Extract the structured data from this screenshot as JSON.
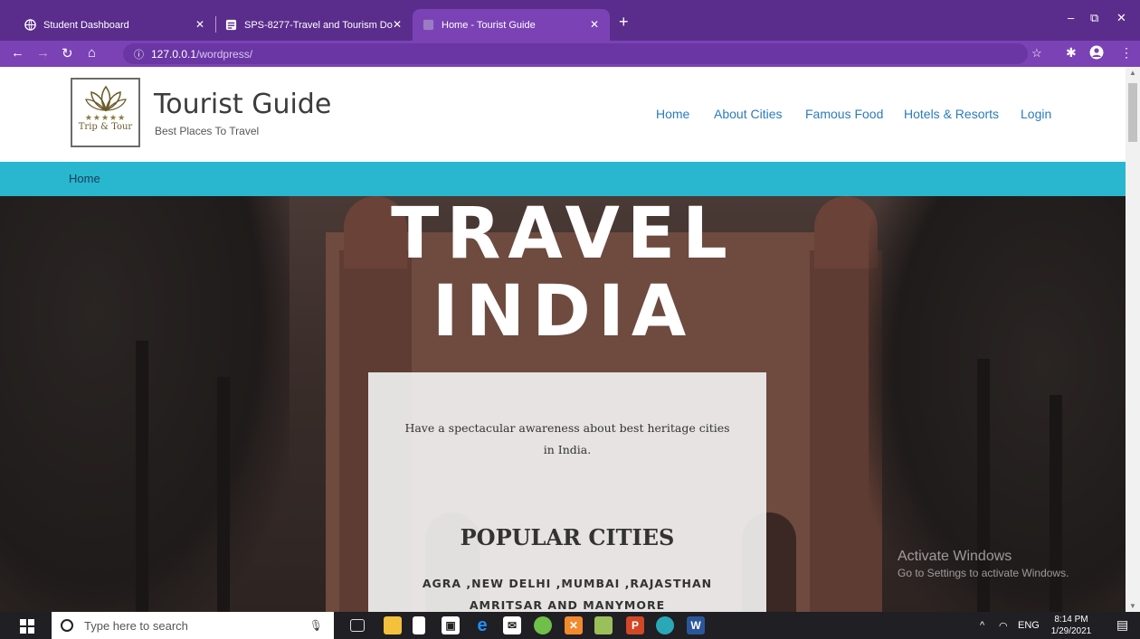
{
  "browser": {
    "tabs": [
      {
        "title": "Student Dashboard"
      },
      {
        "title": "SPS-8277-Travel and Tourism Do"
      },
      {
        "title": "Home - Tourist Guide"
      }
    ],
    "new_tab": "+",
    "window_controls": {
      "minimize": "–",
      "maximize": "⧉",
      "close": "✕"
    },
    "url_host": "127.0.0.1",
    "url_path": "/wordpress/"
  },
  "site": {
    "logo_stars": "★★★★★",
    "logo_text": "Trip & Tour",
    "title": "Tourist Guide",
    "tagline": "Best Places To Travel",
    "nav": [
      "Home",
      "About Cities",
      "Famous Food",
      "Hotels & Resorts",
      "Login"
    ],
    "breadcrumb": "Home"
  },
  "hero": {
    "title_line1": "TRAVEL",
    "title_line2": "INDIA",
    "card_text": "Have a spectacular awareness about best heritage cities in India.",
    "card_heading": "POPULAR CITIES",
    "card_cities": "AGRA ,NEW DELHI ,MUMBAI ,RAJASTHAN AMRITSAR AND MANYMORE"
  },
  "watermark": {
    "line1": "Activate Windows",
    "line2": "Go to Settings to activate Windows."
  },
  "taskbar": {
    "search_placeholder": "Type here to search",
    "tray_lang": "ENG",
    "time": "8:14 PM",
    "date": "1/29/2021"
  },
  "colors": {
    "browser_frame": "#5a2d8c",
    "nav_link": "#2b7bbd",
    "subbar": "#29b6cf"
  }
}
